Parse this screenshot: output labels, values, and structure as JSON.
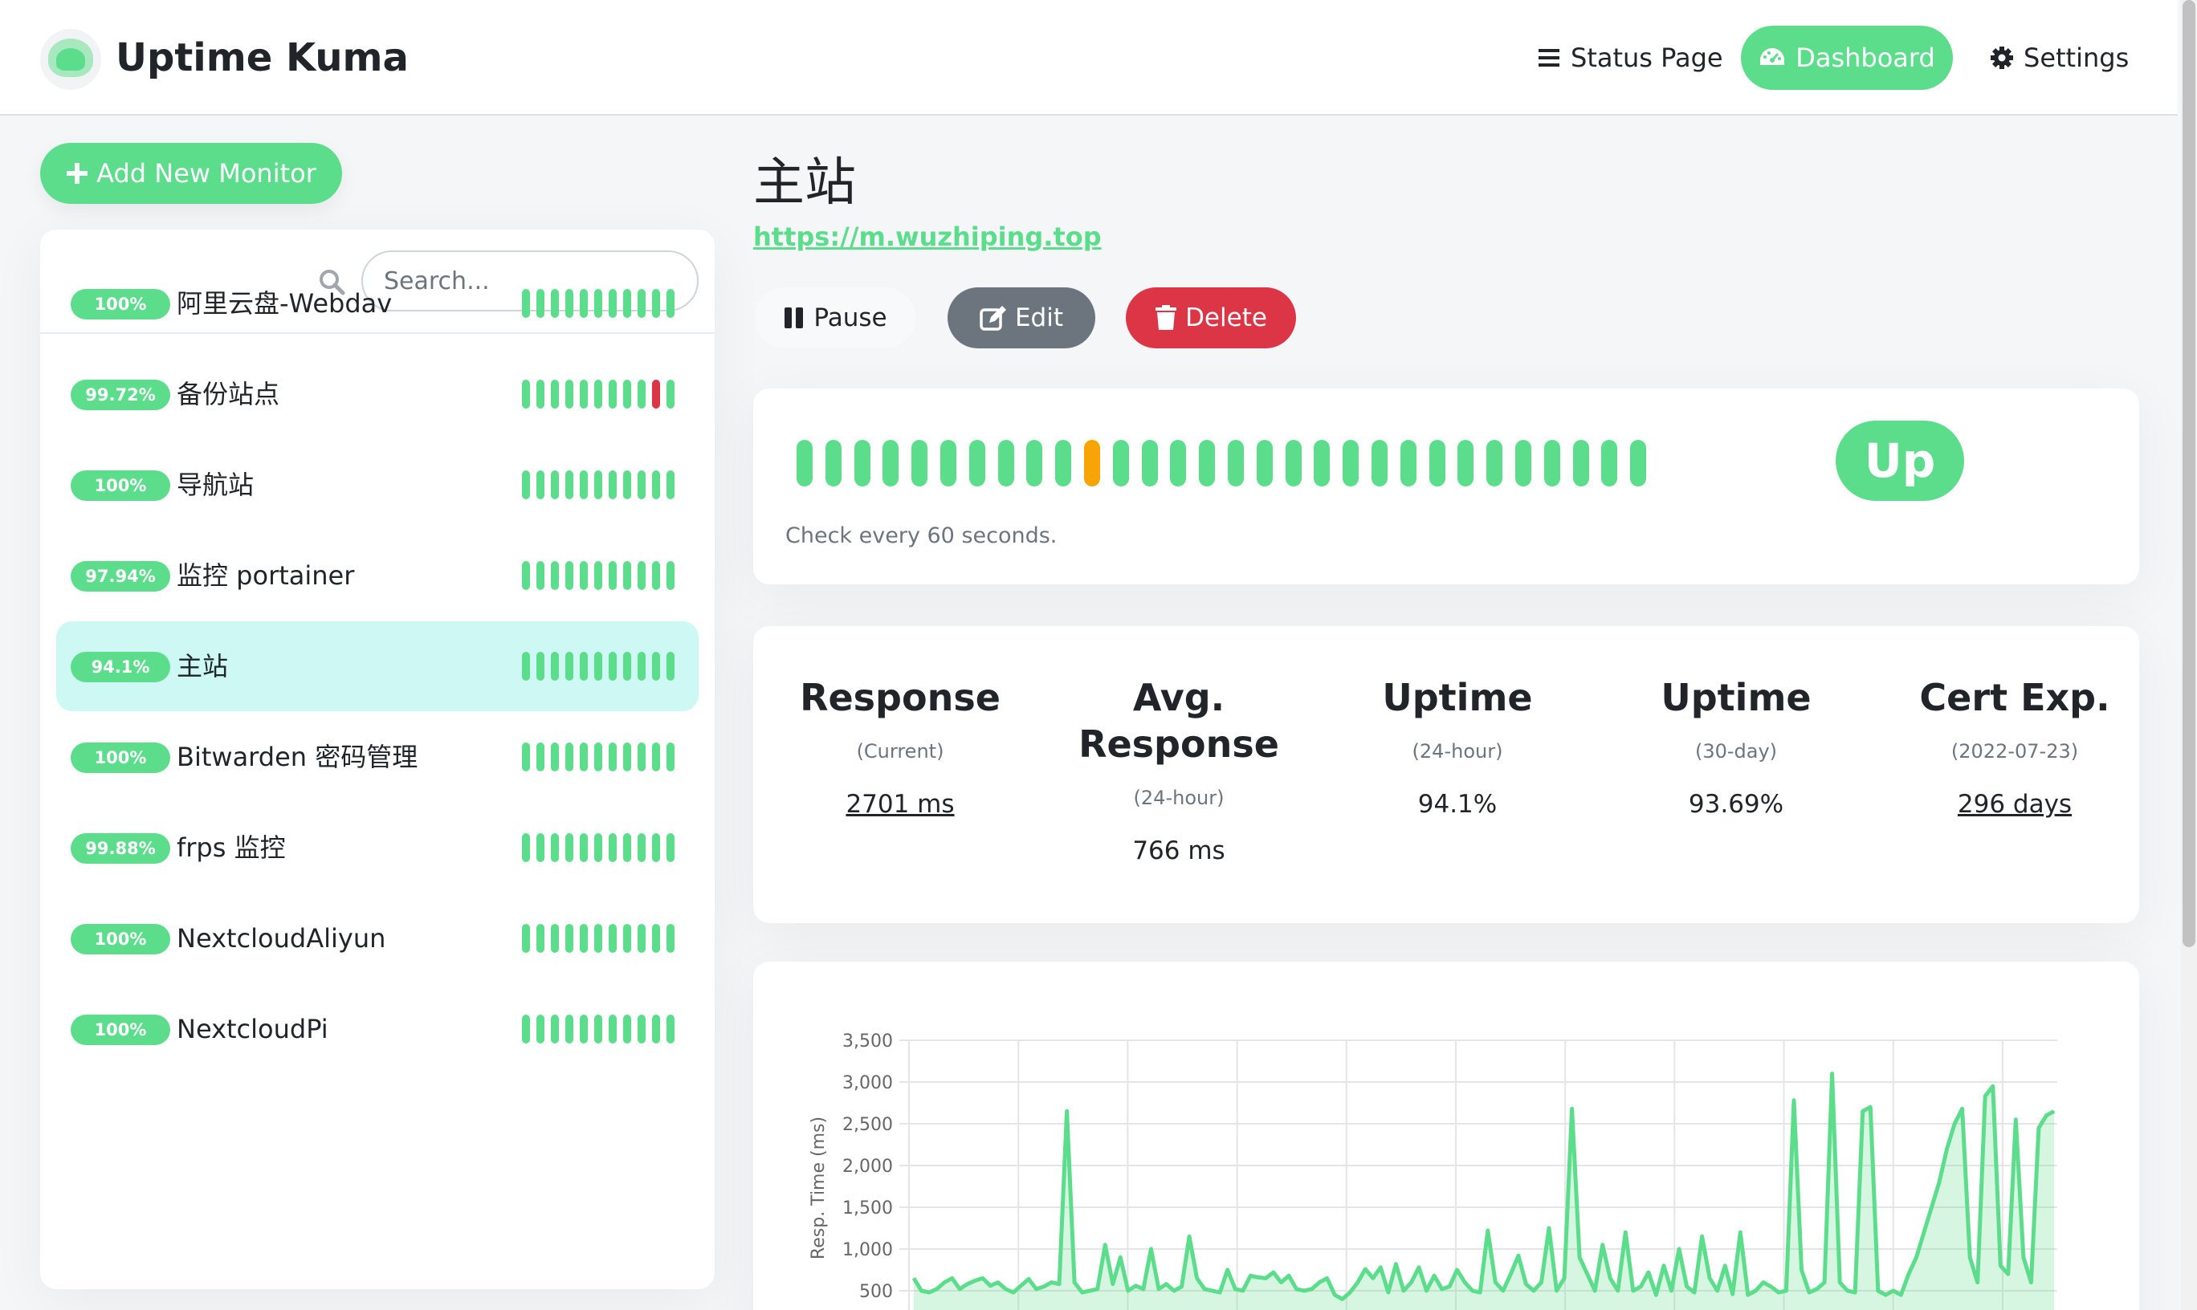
{
  "header": {
    "brand": "Uptime Kuma",
    "nav": {
      "status_page": "Status Page",
      "dashboard": "Dashboard",
      "settings": "Settings"
    }
  },
  "colors": {
    "accent": "#5cdd8b",
    "warning": "#f8a306",
    "danger": "#dc3545",
    "active_row": "#cdf8f4"
  },
  "sidebar": {
    "add_button": "Add New Monitor",
    "search_placeholder": "Search...",
    "monitors": [
      {
        "uptime": "100%",
        "name": "阿里云盘-Webdav",
        "beats": [
          "up",
          "up",
          "up",
          "up",
          "up",
          "up",
          "up",
          "up",
          "up",
          "up",
          "up"
        ]
      },
      {
        "uptime": "99.72%",
        "name": "备份站点",
        "beats": [
          "up",
          "up",
          "up",
          "up",
          "up",
          "up",
          "up",
          "up",
          "up",
          "down",
          "up"
        ]
      },
      {
        "uptime": "100%",
        "name": "导航站",
        "beats": [
          "up",
          "up",
          "up",
          "up",
          "up",
          "up",
          "up",
          "up",
          "up",
          "up",
          "up"
        ]
      },
      {
        "uptime": "97.94%",
        "name": "监控 portainer",
        "beats": [
          "up",
          "up",
          "up",
          "up",
          "up",
          "up",
          "up",
          "up",
          "up",
          "up",
          "up"
        ]
      },
      {
        "uptime": "94.1%",
        "name": "主站",
        "beats": [
          "up",
          "up",
          "up",
          "up",
          "up",
          "up",
          "up",
          "up",
          "up",
          "up",
          "up"
        ],
        "active": true
      },
      {
        "uptime": "100%",
        "name": "Bitwarden 密码管理",
        "beats": [
          "up",
          "up",
          "up",
          "up",
          "up",
          "up",
          "up",
          "up",
          "up",
          "up",
          "up"
        ]
      },
      {
        "uptime": "99.88%",
        "name": "frps 监控",
        "beats": [
          "up",
          "up",
          "up",
          "up",
          "up",
          "up",
          "up",
          "up",
          "up",
          "up",
          "up"
        ]
      },
      {
        "uptime": "100%",
        "name": "NextcloudAliyun",
        "beats": [
          "up",
          "up",
          "up",
          "up",
          "up",
          "up",
          "up",
          "up",
          "up",
          "up",
          "up"
        ]
      },
      {
        "uptime": "100%",
        "name": "NextcloudPi",
        "beats": [
          "up",
          "up",
          "up",
          "up",
          "up",
          "up",
          "up",
          "up",
          "up",
          "up",
          "up"
        ]
      }
    ]
  },
  "monitor": {
    "title": "主站",
    "url": "https://m.wuzhiping.top",
    "actions": {
      "pause": "Pause",
      "edit": "Edit",
      "delete": "Delete"
    },
    "status": "Up",
    "check_text": "Check every 60 seconds.",
    "heartbeats": [
      "up",
      "up",
      "up",
      "up",
      "up",
      "up",
      "up",
      "up",
      "up",
      "up",
      "pending",
      "up",
      "up",
      "up",
      "up",
      "up",
      "up",
      "up",
      "up",
      "up",
      "up",
      "up",
      "up",
      "up",
      "up",
      "up",
      "up",
      "up",
      "up",
      "up"
    ]
  },
  "stats": [
    {
      "title": "Response",
      "sub": "(Current)",
      "value": "2701 ms",
      "underline": true
    },
    {
      "title": "Avg. Response",
      "sub": "(24-hour)",
      "value": "766 ms",
      "underline": false
    },
    {
      "title": "Uptime",
      "sub": "(24-hour)",
      "value": "94.1%",
      "underline": false
    },
    {
      "title": "Uptime",
      "sub": "(30-day)",
      "value": "93.69%",
      "underline": false
    },
    {
      "title": "Cert Exp.",
      "sub": "(2022-07-23)",
      "value": "296 days",
      "underline": true
    }
  ],
  "chart_data": {
    "type": "area",
    "title": "",
    "xlabel": "",
    "ylabel": "Resp. Time (ms)",
    "ylim": [
      0,
      3500
    ],
    "y_ticks": [
      "3,500",
      "3,000",
      "2,500",
      "2,000",
      "1,500",
      "1,000",
      "500"
    ],
    "grid": true,
    "legend": "none",
    "series": [
      {
        "values": [
          650,
          500,
          480,
          520,
          600,
          650,
          520,
          580,
          620,
          650,
          560,
          600,
          520,
          480,
          560,
          640,
          520,
          550,
          600,
          580,
          2650,
          600,
          480,
          500,
          520,
          1050,
          580,
          900,
          500,
          560,
          520,
          1000,
          520,
          580,
          500,
          550,
          1150,
          650,
          520,
          500,
          480,
          750,
          520,
          500,
          680,
          660,
          650,
          720,
          600,
          680,
          520,
          500,
          520,
          600,
          650,
          450,
          400,
          480,
          600,
          760,
          650,
          780,
          480,
          820,
          500,
          600,
          780,
          500,
          680,
          520,
          550,
          750,
          600,
          500,
          480,
          1220,
          600,
          500,
          700,
          920,
          580,
          500,
          600,
          1250,
          500,
          650,
          2680,
          900,
          700,
          500,
          1050,
          650,
          500,
          1200,
          500,
          550,
          720,
          450,
          800,
          500,
          1000,
          550,
          480,
          1150,
          650,
          500,
          800,
          460,
          1200,
          450,
          500,
          600,
          550,
          480,
          500,
          2780,
          750,
          480,
          520,
          600,
          3100,
          600,
          500,
          480,
          2650,
          2700,
          500,
          450,
          500,
          450,
          700,
          900,
          1200,
          1500,
          1800,
          2200,
          2500,
          2680,
          900,
          600,
          2830,
          2950,
          800,
          700,
          2550,
          900,
          600,
          2450,
          2600,
          2650
        ]
      }
    ]
  }
}
